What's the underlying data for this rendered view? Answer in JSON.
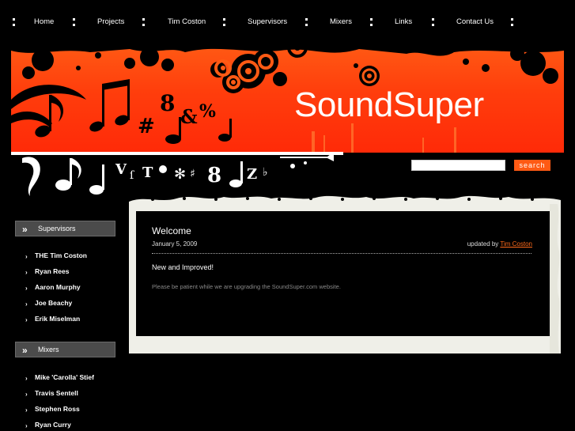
{
  "nav": {
    "items": [
      {
        "label": "Home"
      },
      {
        "label": "Projects"
      },
      {
        "label": "Tim Coston"
      },
      {
        "label": "Supervisors"
      },
      {
        "label": "Mixers"
      },
      {
        "label": "Links"
      },
      {
        "label": "Contact Us"
      }
    ]
  },
  "banner": {
    "title": "SoundSuper"
  },
  "search": {
    "button_label": "search",
    "value": ""
  },
  "sidebar": {
    "sections": [
      {
        "title": "Supervisors",
        "icon": "double-chevron-icon",
        "items": [
          {
            "label": "THE Tim Coston"
          },
          {
            "label": "Ryan Rees"
          },
          {
            "label": "Aaron Murphy"
          },
          {
            "label": "Joe Beachy"
          },
          {
            "label": "Erik Miselman"
          }
        ]
      },
      {
        "title": "Mixers",
        "icon": "double-chevron-icon",
        "items": [
          {
            "label": "Mike 'Carolla' Stief"
          },
          {
            "label": "Travis Sentell"
          },
          {
            "label": "Stephen Ross"
          },
          {
            "label": "Ryan Curry"
          }
        ]
      }
    ]
  },
  "post": {
    "title": "Welcome",
    "date": "January 5, 2009",
    "byline_prefix": "updated by",
    "author": "Tim Coston",
    "lead": "New and Improved!",
    "body": "Please be patient while we are upgrading the SoundSuper.com website."
  },
  "colors": {
    "accent": "#ff5a14",
    "author_link": "#ff6a1a",
    "background": "#000000"
  }
}
